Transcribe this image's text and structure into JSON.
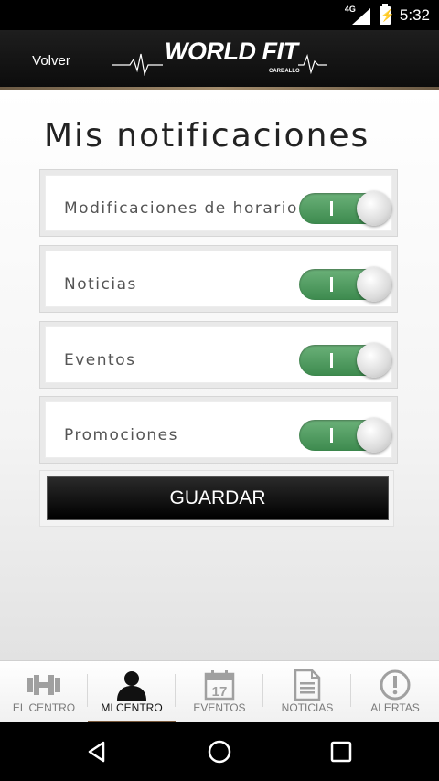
{
  "status_bar": {
    "network": "4G",
    "time": "5:32"
  },
  "header": {
    "back_label": "Volver",
    "logo_text": "WORLD FIT",
    "logo_sub": "CARBALLO"
  },
  "page": {
    "title": "Mis notificaciones"
  },
  "notifications": [
    {
      "label": "Modificaciones de horario",
      "enabled": true
    },
    {
      "label": "Noticias",
      "enabled": true
    },
    {
      "label": "Eventos",
      "enabled": true
    },
    {
      "label": "Promociones",
      "enabled": true
    }
  ],
  "save_label": "GUARDAR",
  "tabs": [
    {
      "label": "EL CENTRO",
      "icon": "dumbbell-icon",
      "active": false
    },
    {
      "label": "MI CENTRO",
      "icon": "person-icon",
      "active": true
    },
    {
      "label": "EVENTOS",
      "icon": "calendar-icon",
      "calendar_day": "17",
      "active": false
    },
    {
      "label": "NOTICIAS",
      "icon": "document-icon",
      "active": false
    },
    {
      "label": "ALERTAS",
      "icon": "alert-icon",
      "active": false
    }
  ],
  "colors": {
    "toggle_on": "#4a9a5c",
    "accent": "#7a5a3c"
  }
}
